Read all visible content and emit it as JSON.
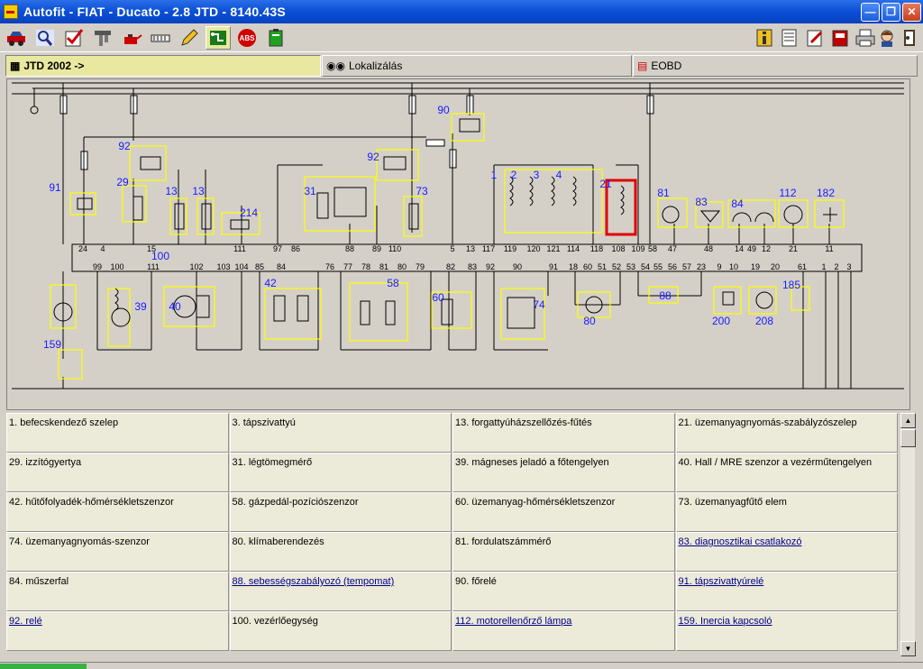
{
  "window": {
    "title": "Autofit - FIAT - Ducato - 2.8 JTD - 8140.43S"
  },
  "toolbar": {
    "left_icons": [
      "car-icon",
      "search-icon",
      "checklist-icon",
      "sensor-icon",
      "oil-can-icon",
      "connector-icon",
      "pencil-icon",
      "circuit-icon",
      "abs-icon",
      "battery-icon"
    ],
    "right_icons": [
      "info-icon",
      "document-icon",
      "edit-icon",
      "notebook-icon",
      "print-icon",
      "user-icon",
      "exit-icon"
    ],
    "active": "circuit-icon"
  },
  "tabs": [
    {
      "label": "JTD 2002 ->",
      "selected": true,
      "icon": "circuit-icon"
    },
    {
      "label": "Lokalizálás",
      "selected": false,
      "icon": "binoculars-icon"
    },
    {
      "label": "EOBD",
      "selected": false,
      "icon": "obd-icon"
    }
  ],
  "diagram": {
    "top_connector_pins": [
      "24",
      "4",
      "15",
      "111",
      "97",
      "86",
      "88",
      "89",
      "110",
      "5",
      "13",
      "117",
      "119",
      "120",
      "121",
      "114",
      "118",
      "108",
      "109",
      "58",
      "47",
      "48",
      "14",
      "49",
      "12",
      "21",
      "11"
    ],
    "bottom_connector_pins": [
      "99",
      "100",
      "111",
      "102",
      "103",
      "104",
      "85",
      "84",
      "76",
      "77",
      "78",
      "81",
      "80",
      "79",
      "82",
      "83",
      "92",
      "90",
      "91",
      "18",
      "60",
      "51",
      "52",
      "53",
      "54",
      "55",
      "56",
      "57",
      "23",
      "9",
      "10",
      "19",
      "20",
      "61",
      "1",
      "2",
      "3"
    ],
    "component_labels": [
      "1",
      "2",
      "3",
      "4",
      "13",
      "13",
      "21",
      "29",
      "31",
      "39",
      "40",
      "42",
      "58",
      "60",
      "73",
      "74",
      "80",
      "81",
      "83",
      "84",
      "88",
      "90",
      "91",
      "92",
      "92",
      "100",
      "112",
      "159",
      "182",
      "185",
      "200",
      "208",
      "214"
    ],
    "highlighted_component": "21",
    "accent": "#1a1aff",
    "highlight_color": "#e00000",
    "component_box_color": "#ffff00"
  },
  "legend": {
    "items": [
      {
        "text": "1. befecskendező szelep",
        "link": false
      },
      {
        "text": "3. tápszivattyú",
        "link": false
      },
      {
        "text": "13. forgattyúházszellőzés-fűtés",
        "link": false
      },
      {
        "text": "21. üzemanyagnyomás-szabályzószelep",
        "link": false
      },
      {
        "text": "29. izzítógyertya",
        "link": false
      },
      {
        "text": "31. légtömegmérő",
        "link": false
      },
      {
        "text": "39. mágneses jeladó a főtengelyen",
        "link": false
      },
      {
        "text": "40. Hall / MRE szenzor a vezérműtengelyen",
        "link": false
      },
      {
        "text": "42. hűtőfolyadék-hőmérsékletszenzor",
        "link": false
      },
      {
        "text": "58. gázpedál-pozíciószenzor",
        "link": false
      },
      {
        "text": "60. üzemanyag-hőmérsékletszenzor",
        "link": false
      },
      {
        "text": "73. üzemanyagfűtő elem",
        "link": false
      },
      {
        "text": "74. üzemanyagnyomás-szenzor",
        "link": false
      },
      {
        "text": "80. klímaberendezés",
        "link": false
      },
      {
        "text": "81. fordulatszámmérő",
        "link": false
      },
      {
        "text": "83. diagnosztikai csatlakozó",
        "link": true
      },
      {
        "text": "84. műszerfal",
        "link": false
      },
      {
        "text": "88. sebességszabályozó (tempomat)",
        "link": true
      },
      {
        "text": "90. főrelé",
        "link": false
      },
      {
        "text": "91. tápszivattyúrelé",
        "link": true
      },
      {
        "text": "92. relé",
        "link": true
      },
      {
        "text": "100. vezérlőegység",
        "link": false
      },
      {
        "text": "112. motorellenőrző lámpa",
        "link": true
      },
      {
        "text": "159. Inercia kapcsoló",
        "link": true
      }
    ]
  }
}
